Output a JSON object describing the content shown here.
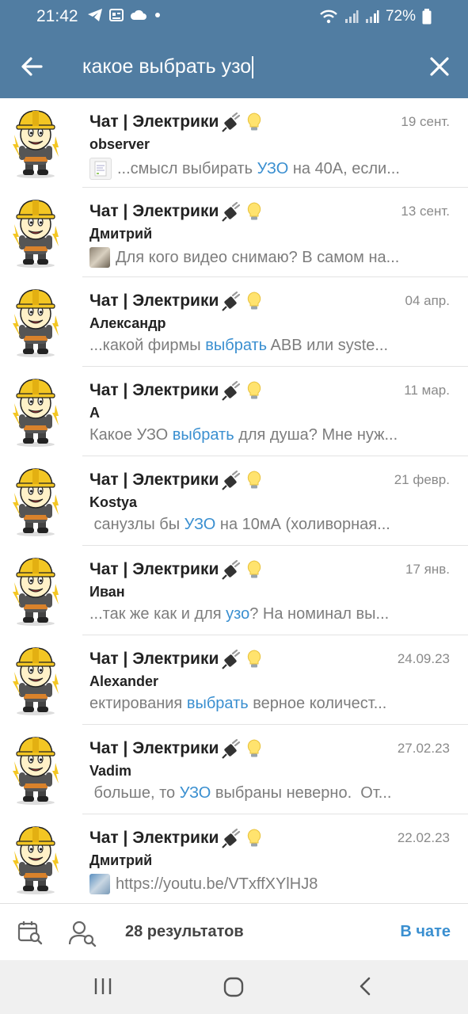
{
  "status": {
    "time": "21:42",
    "battery": "72%",
    "icons": [
      "telegram-icon",
      "news-icon",
      "cloud-icon",
      "dot-icon",
      "wifi-icon",
      "signal-icon",
      "signal-icon",
      "battery-icon"
    ]
  },
  "search": {
    "query": "какое выбрать узо"
  },
  "results": [
    {
      "title": "Чат | Электрики",
      "date": "19 сент.",
      "sender": "observer",
      "thumb": "doc",
      "snippet": [
        {
          "t": "...смысл выбирать "
        },
        {
          "t": "УЗО",
          "h": true
        },
        {
          "t": " на 40А, если..."
        }
      ]
    },
    {
      "title": "Чат | Электрики",
      "date": "13 сент.",
      "sender": "Дмитрий",
      "thumb": "photo",
      "snippet": [
        {
          "t": "Для кого видео снимаю? В самом на..."
        }
      ]
    },
    {
      "title": "Чат | Электрики",
      "date": "04 апр.",
      "sender": "Александр",
      "thumb": "",
      "snippet": [
        {
          "t": "...какой фирмы "
        },
        {
          "t": "выбрать",
          "h": true
        },
        {
          "t": " ABB или syste..."
        }
      ]
    },
    {
      "title": "Чат | Электрики",
      "date": "11 мар.",
      "sender": "А",
      "thumb": "",
      "snippet": [
        {
          "t": "Какое УЗО "
        },
        {
          "t": "выбрать",
          "h": true
        },
        {
          "t": " для душа? Мне нуж..."
        }
      ]
    },
    {
      "title": "Чат | Электрики",
      "date": "21 февр.",
      "sender": "Kostya",
      "thumb": "",
      "snippet": [
        {
          "t": " санузлы бы "
        },
        {
          "t": "УЗО",
          "h": true
        },
        {
          "t": " на 10мА (холиворная..."
        }
      ]
    },
    {
      "title": "Чат | Электрики",
      "date": "17 янв.",
      "sender": "Иван",
      "thumb": "",
      "snippet": [
        {
          "t": "...так же как и для "
        },
        {
          "t": "узо",
          "h": true
        },
        {
          "t": "? На номинал вы..."
        }
      ]
    },
    {
      "title": "Чат | Электрики",
      "date": "24.09.23",
      "sender": "Alexander",
      "thumb": "",
      "snippet": [
        {
          "t": "ектирования "
        },
        {
          "t": "выбрать",
          "h": true
        },
        {
          "t": " верное количест..."
        }
      ]
    },
    {
      "title": "Чат | Электрики",
      "date": "27.02.23",
      "sender": "Vadim",
      "thumb": "",
      "snippet": [
        {
          "t": " больше, то "
        },
        {
          "t": "УЗО",
          "h": true
        },
        {
          "t": " выбраны неверно.  От..."
        }
      ]
    },
    {
      "title": "Чат | Электрики",
      "date": "22.02.23",
      "sender": "Дмитрий",
      "thumb": "photo2",
      "snippet": [
        {
          "t": "https://youtu.be/VTxffXYlHJ8"
        }
      ]
    }
  ],
  "bottom": {
    "count": "28 результатов",
    "in_chat": "В чате"
  },
  "colors": {
    "header": "#517da2",
    "highlight": "#3a8fd0"
  }
}
